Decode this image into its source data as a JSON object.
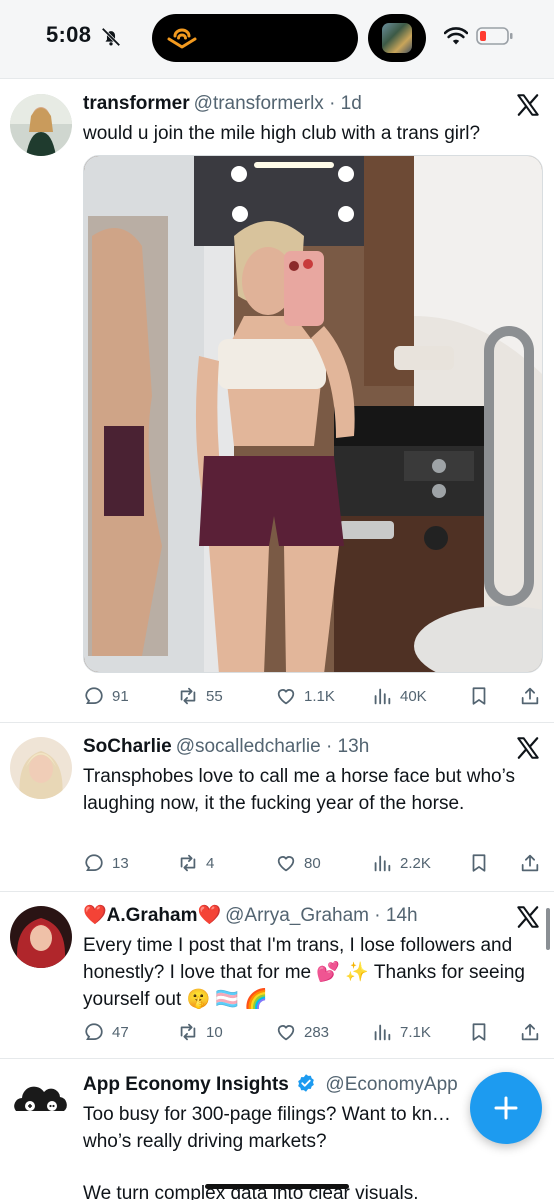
{
  "status_bar": {
    "time": "5:08"
  },
  "tweets": [
    {
      "name": "transformer",
      "handle": "@transformerlx · 1d",
      "text": "would u join the mile high club with a trans girl?",
      "replies": "91",
      "reposts": "55",
      "likes": "1.1K",
      "views": "40K"
    },
    {
      "name": "SoCharlie",
      "handle": "@socalledcharlie · 13h",
      "text": "Transphobes love to call me a horse face but who’s laughing now, it the fucking year of the horse.",
      "replies": "13",
      "reposts": "4",
      "likes": "80",
      "views": "2.2K"
    },
    {
      "name": "❤️A.Graham❤️",
      "handle": "@Arrya_Graham · 14h",
      "text": "Every time I post that I'm trans, I lose followers and honestly? I love that for me 💕 ✨  Thanks for seeing yourself out 🤫 🏳️‍⚧️ 🌈",
      "replies": "47",
      "reposts": "10",
      "likes": "283",
      "views": "7.1K"
    },
    {
      "name": "App Economy Insights",
      "handle": "@EconomyApp",
      "text": "Too busy for 300-page filings? Want to kn… who’s really driving markets?",
      "text2": "We turn complex data into clear visuals."
    }
  ],
  "icons": {
    "reply": "reply-icon",
    "repost": "repost-icon",
    "like": "heart-icon",
    "views": "views-icon",
    "bookmark": "bookmark-icon",
    "share": "share-icon",
    "compose": "plus-icon"
  },
  "colors": {
    "accent": "#1d9bf0",
    "muted": "#536471",
    "battery_low": "#ff3b30"
  }
}
